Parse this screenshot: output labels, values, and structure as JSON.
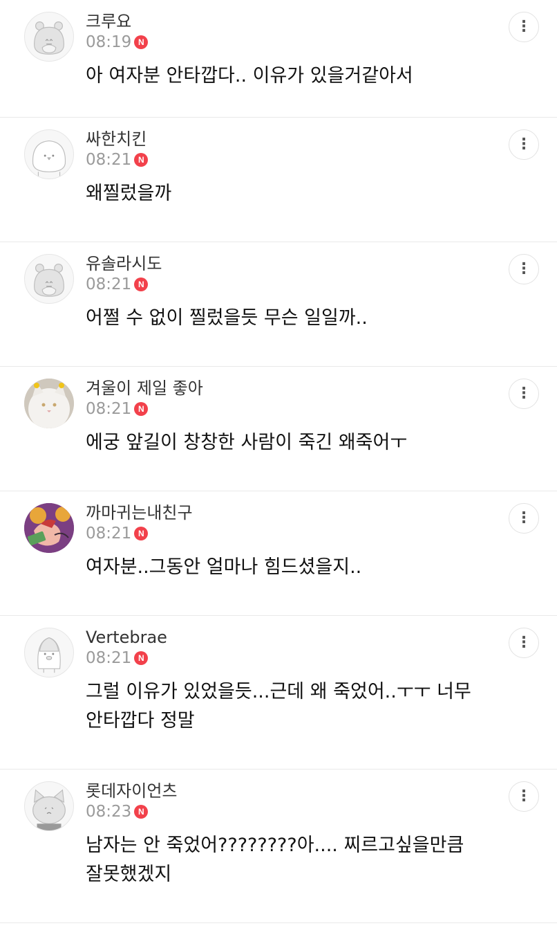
{
  "new_badge": "N",
  "more_glyph": "⋮",
  "comments": [
    {
      "nickname": "크루요",
      "time": "08:19",
      "text": "아 여자분 안타깝다.. 이유가 있을거같아서",
      "avatar": "default-hamster-icon"
    },
    {
      "nickname": "싸한치킨",
      "time": "08:21",
      "text": "왜찔렀을까",
      "avatar": "default-chick-icon"
    },
    {
      "nickname": "유솔라시도",
      "time": "08:21",
      "text": "어쩔 수 없이 찔렀을듯 무슨 일일까..",
      "avatar": "default-hamster-icon"
    },
    {
      "nickname": "겨울이 제일 좋아",
      "time": "08:21",
      "text": "에궁 앞길이 창창한 사람이 죽긴 왜죽어ㅜ",
      "avatar": "white-cat-photo"
    },
    {
      "nickname": "까마귀는내친구",
      "time": "08:21",
      "text": "여자분..그동안 얼마나 힘드셨을지..",
      "avatar": "illustration-photo"
    },
    {
      "nickname": "Vertebrae",
      "time": "08:21",
      "text": "그럴 이유가 있었을듯...근데 왜 죽었어..ㅜㅜ 너무 안타깝다 정말",
      "avatar": "default-penguin-icon"
    },
    {
      "nickname": "롯데자이언츠",
      "time": "08:23",
      "text": "남자는 안 죽었어????????아.... 찌르고싶을만큼 잘못했겠지",
      "avatar": "default-cat-icon"
    }
  ],
  "colors": {
    "badge": "#f2414b",
    "divider": "#e9e9e9",
    "time": "#9a9a9a"
  }
}
